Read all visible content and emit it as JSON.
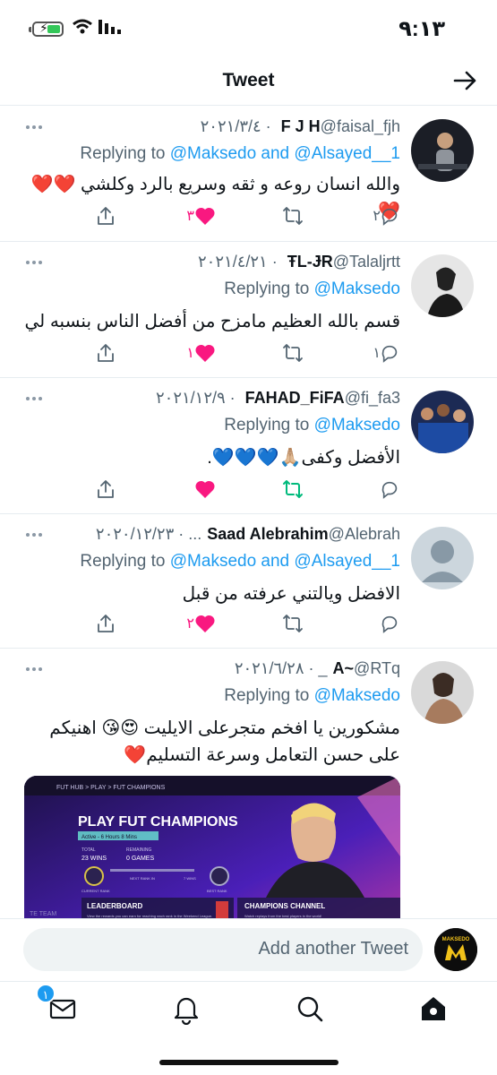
{
  "status_bar": {
    "time": "٩:١٣"
  },
  "header": {
    "title": "Tweet"
  },
  "tweets": [
    {
      "name": "F J H",
      "handle": "@faisal_fjh",
      "date": "٢٠٢١/٣/٤",
      "replying": "Replying to ",
      "mentions": "@Maksedo and @Alsayed__1",
      "text": "والله انسان روعه و ثقه وسريع بالرد وكلشي ❤️❤️❤️",
      "replies": "٢",
      "retweets": "",
      "likes": "٣",
      "liked": true
    },
    {
      "name": "ŦL-ɈR",
      "handle": "@Talaljrtt",
      "date": "٢٠٢١/٤/٢١",
      "replying": "Replying to ",
      "mentions": "@Maksedo",
      "text": "قسم بالله العظيم مامزح من أفضل الناس بنسبه لي",
      "replies": "١",
      "retweets": "",
      "likes": "١",
      "liked": true
    },
    {
      "name": "FAHAD_FiFA",
      "handle": "@fi_fa3",
      "date": "٢٠٢١/١٢/٩",
      "replying": "Replying to ",
      "mentions": "@Maksedo",
      "text": "الأفضل وكفى🙏🏼💙💙💙.",
      "replies": "",
      "retweets": "",
      "likes": "",
      "liked": true,
      "retweeted": true
    },
    {
      "name": "Saad Alebrahim",
      "handle": "@Alebrah...",
      "date": "٢٠٢٠/١٢/٢٣",
      "replying": "Replying to ",
      "mentions": "@Maksedo and @Alsayed__1",
      "text": "الافضل ويالتني عرفته من قبل",
      "replies": "",
      "retweets": "",
      "likes": "٢",
      "liked": true
    },
    {
      "name": "A~",
      "handle": "@RTq_",
      "date": "٢٠٢١/٦/٢٨",
      "replying": "Replying to ",
      "mentions": "@Maksedo",
      "text": "مشكورين يا افخم متجرعلى الايليت 😍😘 اهنيكم على حسن التعامل وسرعة التسليم❤️"
    }
  ],
  "media": {
    "crumb": "FUT HUB > PLAY > FUT CHAMPIONS",
    "title": "PLAY FUT CHAMPIONS",
    "status": "Active - 6 Hours 8 Mins",
    "total_label": "TOTAL",
    "total_value": "23 WINS",
    "remaining_label": "REMAINING",
    "remaining_value": "0 GAMES",
    "current_rank": "CURRENT RANK",
    "next_rank": "NEXT RANK IN",
    "wins_needed": "7 WINS",
    "best_rank": "BEST RANK",
    "leaderboard": "LEADERBOARD",
    "leaderboard_desc": "View the rewards you can earn for reaching each rank in the Weekend League.",
    "channel": "CHAMPIONS CHANNEL",
    "channel_desc": "Watch replays from the best players in the world!",
    "team": "TE TEAM"
  },
  "compose": {
    "placeholder": "Add another Tweet",
    "avatar_text": "MAKSEDO"
  },
  "tabbar": {
    "messages_badge": "١"
  },
  "colors": {
    "accent": "#1d9bf0",
    "like": "#f91880",
    "retweet": "#00ba7c",
    "text": "#0f1419",
    "muted": "#536471"
  }
}
